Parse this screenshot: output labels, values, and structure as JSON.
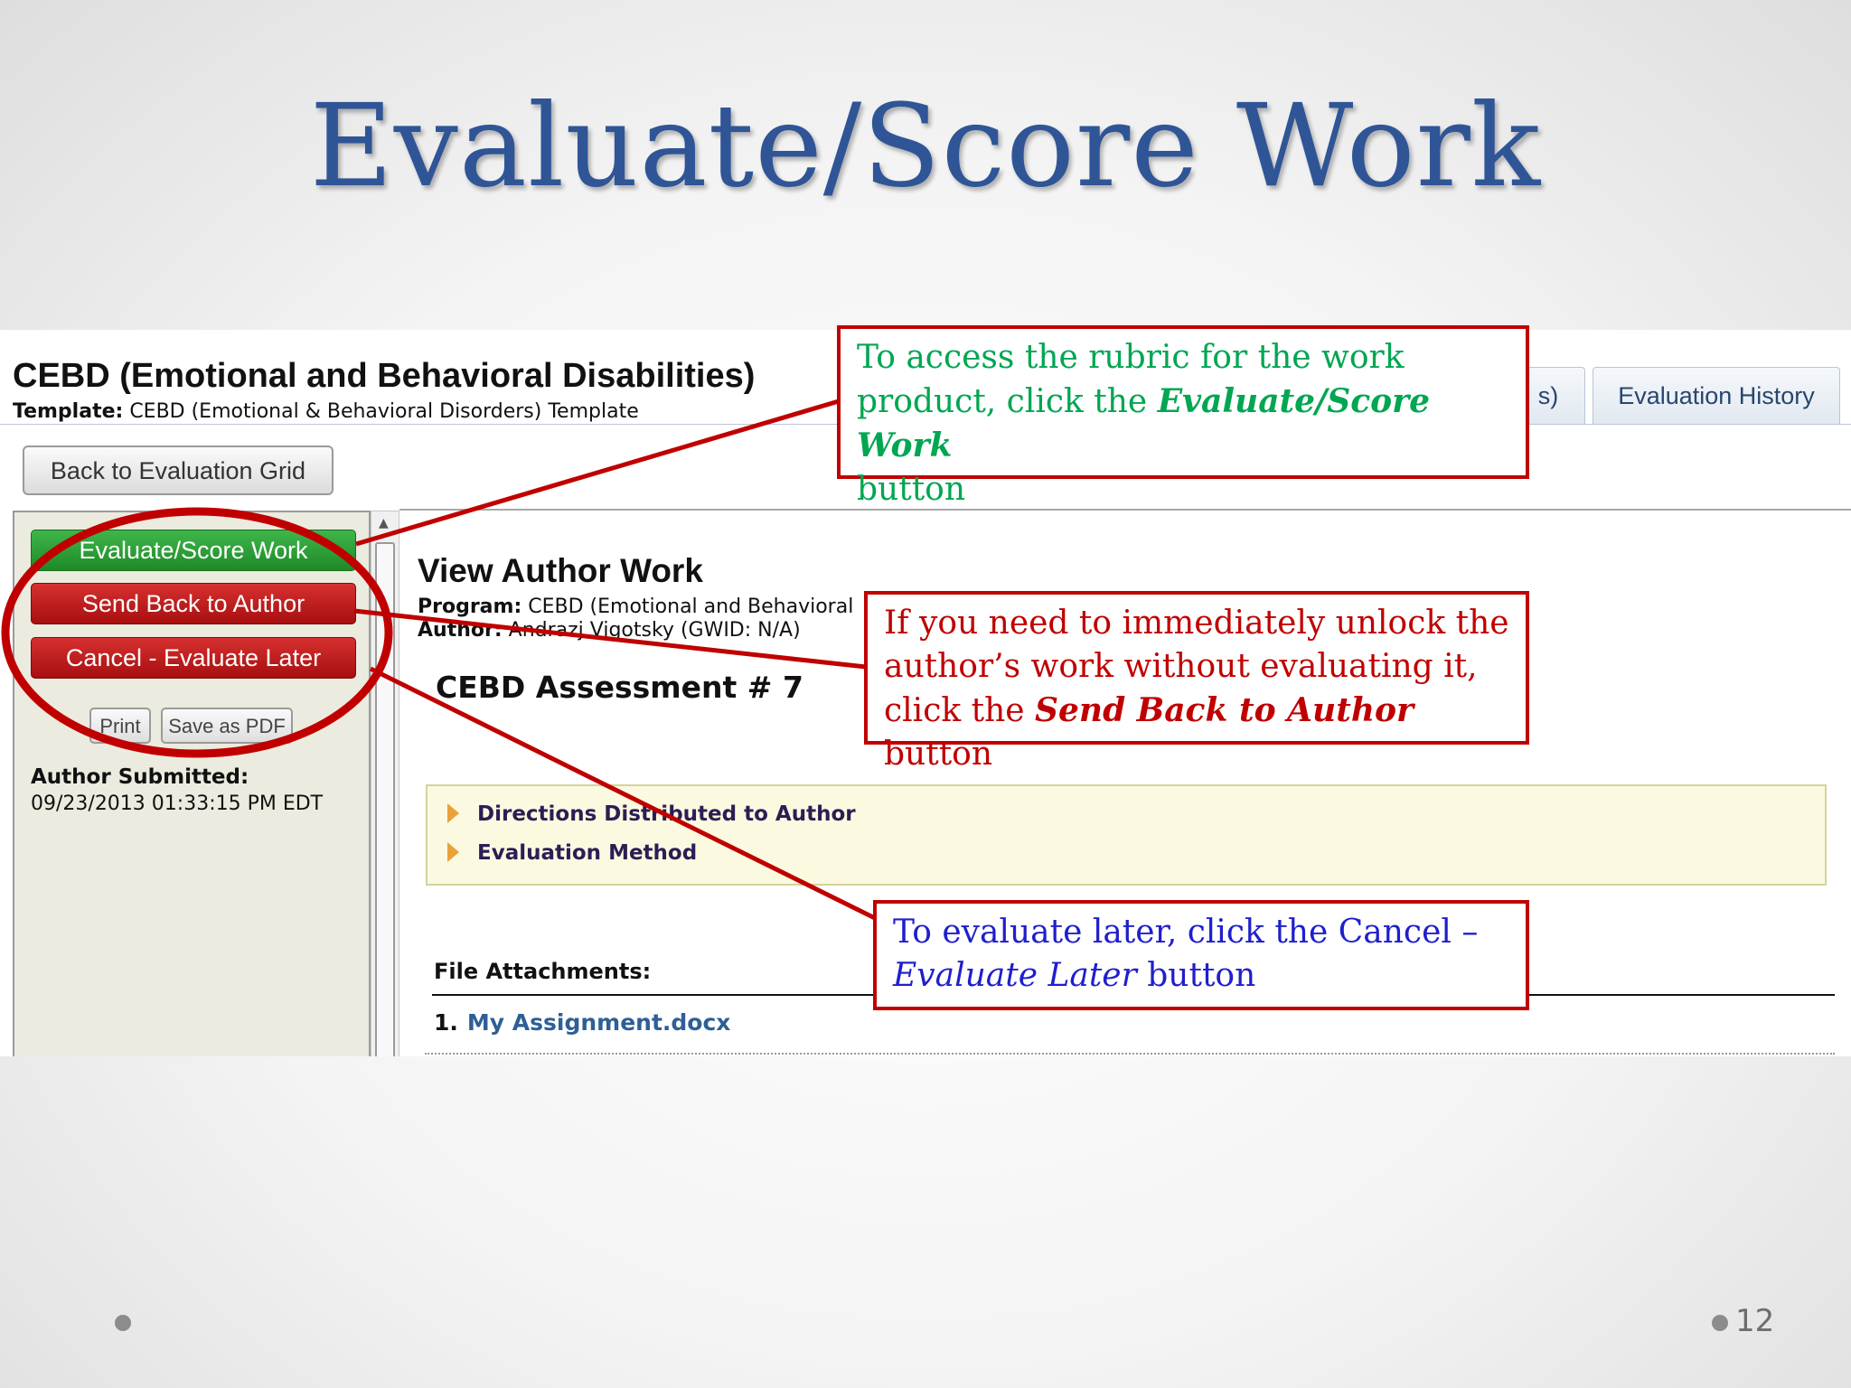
{
  "slide": {
    "title": "Evaluate/Score Work",
    "page_number": "12"
  },
  "app": {
    "heading": "CEBD (Emotional and Behavioral Disabilities)",
    "template_label": "Template:",
    "template_value": "CEBD (Emotional & Behavioral Disorders) Template",
    "tabs": [
      {
        "label": "s)"
      },
      {
        "label": "Evaluation History"
      }
    ],
    "back_button": "Back to Evaluation Grid",
    "actions": {
      "evaluate": "Evaluate/Score Work",
      "send_back": "Send Back to Author",
      "cancel": "Cancel - Evaluate Later",
      "print": "Print",
      "save_pdf": "Save as PDF"
    },
    "submitted_label": "Author Submitted:",
    "submitted_value": "09/23/2013 01:33:15 PM EDT",
    "view": {
      "title": "View Author Work",
      "program_label": "Program:",
      "program_value": "CEBD (Emotional and Behavioral",
      "author_label": "Author:",
      "author_value": "Andrazj Vigotsky (GWID: N/A)",
      "assessment": "CEBD Assessment # 7",
      "expanders": [
        "Directions Distributed to Author",
        "Evaluation Method"
      ],
      "attachments_label": "File Attachments:",
      "attachments": [
        {
          "index": "1.",
          "name": "My Assignment.docx"
        }
      ]
    }
  },
  "callouts": {
    "evaluate": {
      "line1": "To access the rubric for the work",
      "line2_pre": "product, click the ",
      "line2_em": "Evaluate/Score Work",
      "line3": "button"
    },
    "send_back": {
      "line1": "If you need to immediately unlock the",
      "line2": "author’s work without evaluating it,",
      "line3_pre": "click the ",
      "line3_em": "Send Back to Author",
      "line3_post": " button"
    },
    "cancel": {
      "line1": "To evaluate later, click the Cancel –",
      "line2_em": "Evaluate Later",
      "line2_post": " button"
    }
  },
  "colors": {
    "title_blue": "#2f5597",
    "annotation_red": "#c00000",
    "green_text": "#00a651",
    "blue_text": "#1f1fcc"
  }
}
